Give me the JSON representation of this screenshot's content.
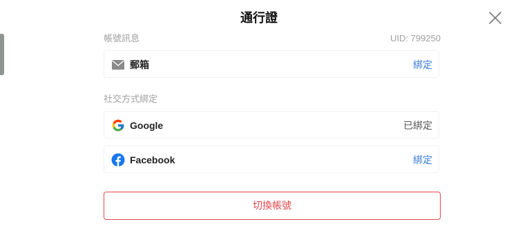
{
  "header": {
    "title": "通行證"
  },
  "account": {
    "section_label": "帳號訊息",
    "uid": "UID: 799250",
    "email": {
      "icon": "mail-icon",
      "label": "郵箱",
      "action": "綁定"
    }
  },
  "social": {
    "section_label": "社交方式綁定",
    "items": [
      {
        "icon": "google-icon",
        "label": "Google",
        "action": "已綁定",
        "bound": true
      },
      {
        "icon": "facebook-icon",
        "label": "Facebook",
        "action": "綁定",
        "bound": false
      }
    ]
  },
  "footer": {
    "switch_label": "切換帳號"
  },
  "colors": {
    "link": "#3a7bd5",
    "danger": "#e0474c",
    "muted": "#a0a0a0",
    "facebook": "#1877f2"
  }
}
